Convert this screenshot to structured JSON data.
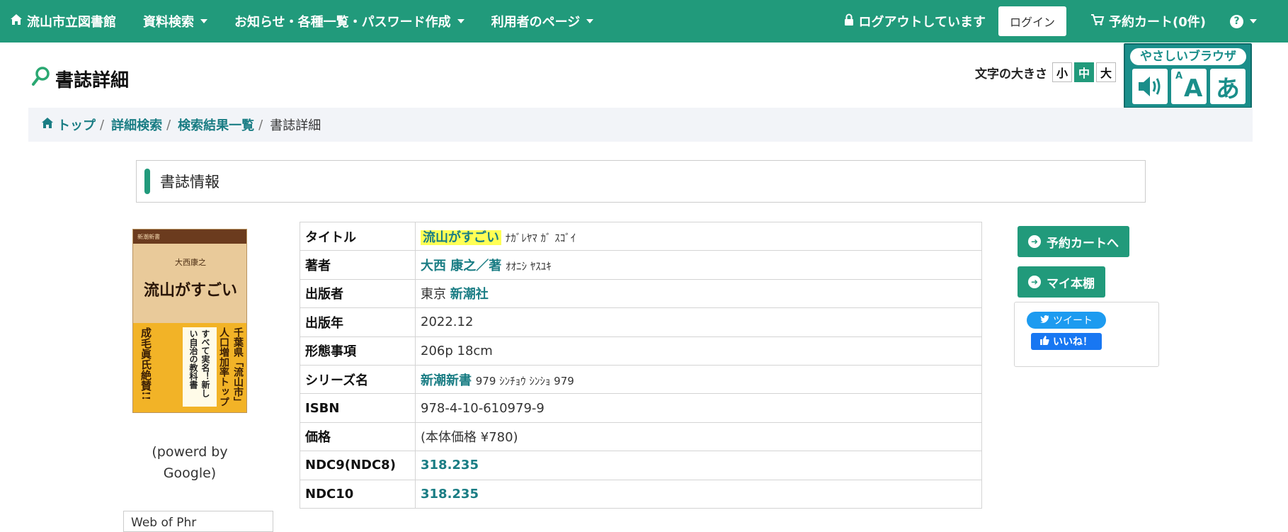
{
  "nav": {
    "brand": "流山市立図書館",
    "menu": [
      "資料検索",
      "お知らせ・各種一覧・パスワード作成",
      "利用者のページ"
    ],
    "logout_status": "ログアウトしています",
    "login": "ログイン",
    "cart": "予約カート(0件)",
    "help": "?"
  },
  "page": {
    "title": "書誌詳細"
  },
  "font_size": {
    "label": "文字の大きさ",
    "small": "小",
    "medium": "中",
    "large": "大",
    "selected": "中"
  },
  "yasashii": {
    "label": "やさしいブラウザ"
  },
  "breadcrumb": {
    "top": "トップ",
    "search": "詳細検索",
    "results": "検索結果一覧",
    "current": "書誌詳細",
    "sep": "/"
  },
  "section": {
    "title": "書誌情報"
  },
  "cover": {
    "series_label": "新潮新書",
    "author": "大西康之",
    "title": "流山がすごい",
    "band1": "千葉県「流山市」人口増加率トップ独走中",
    "band2": "すべて実名！新しい自治の教科書",
    "band3": "成毛眞氏絶賛!!"
  },
  "powered": "(powerd by Google)",
  "side_box": "Web of Phr",
  "book": {
    "rows": [
      {
        "key": "タイトル",
        "value": "流山がすごい",
        "kana": "ﾅｶﾞﾚﾔﾏ ｶﾞ ｽｺﾞｲ"
      },
      {
        "key": "著者",
        "value": "大西 康之／著",
        "kana": "ｵｵﾆｼ ﾔｽﾕｷ"
      },
      {
        "key": "出版者",
        "prefix": "東京",
        "value": "新潮社"
      },
      {
        "key": "出版年",
        "value": "2022.12"
      },
      {
        "key": "形態事項",
        "value": "206p 18cm"
      },
      {
        "key": "シリーズ名",
        "value": "新潮新書",
        "suffix": "979 ｼﾝﾁｮｳ ｼﾝｼｮ 979"
      },
      {
        "key": "ISBN",
        "value": "978-4-10-610979-9"
      },
      {
        "key": "価格",
        "value": "(本体価格 ¥780)"
      },
      {
        "key": "NDC9(NDC8)",
        "value": "318.235"
      },
      {
        "key": "NDC10",
        "value": "318.235"
      }
    ]
  },
  "actions": {
    "cart": "予約カートへ",
    "bookshelf": "マイ本棚"
  },
  "social": {
    "tweet": "ツイート",
    "like": "いいね！"
  },
  "colors": {
    "brand": "#219a7b",
    "link": "#1a7d84",
    "highlight": "#ffff55"
  }
}
